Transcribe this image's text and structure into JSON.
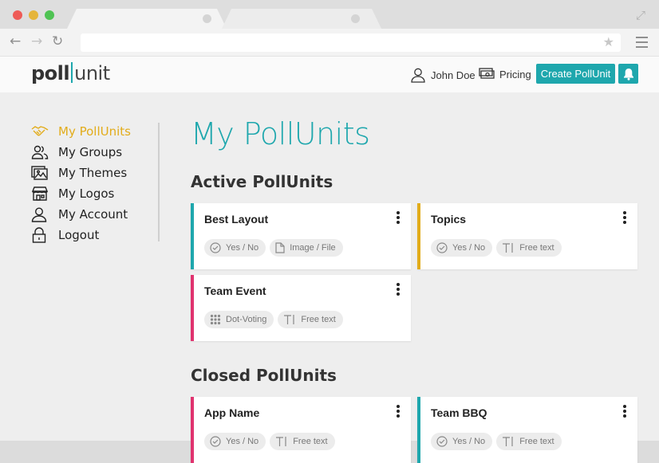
{
  "colors": {
    "brand": "#1ea7ad",
    "active_nav": "#e2ac1a",
    "accent_teal": "#1ea7ad",
    "accent_yellow": "#e2ac1a",
    "accent_pink": "#e0336f"
  },
  "header": {
    "logo_bold": "poll",
    "logo_light": "unit",
    "user_label": "John Doe",
    "pricing_label": "Pricing",
    "create_label": "Create PollUnit"
  },
  "sidebar": {
    "items": [
      {
        "label": "My PollUnits",
        "icon": "handshake-icon"
      },
      {
        "label": "My Groups",
        "icon": "group-icon"
      },
      {
        "label": "My Themes",
        "icon": "image-gallery-icon"
      },
      {
        "label": "My Logos",
        "icon": "storefront-icon"
      },
      {
        "label": "My Account",
        "icon": "user-icon"
      },
      {
        "label": "Logout",
        "icon": "lock-icon"
      }
    ]
  },
  "main": {
    "title": "My PollUnits",
    "active_title": "Active PollUnits",
    "closed_title": "Closed PollUnits",
    "active_cards": [
      {
        "title": "Best Layout",
        "accent": "#1ea7ad",
        "tags": [
          "Yes / No",
          "Image / File"
        ]
      },
      {
        "title": "Topics",
        "accent": "#e2ac1a",
        "tags": [
          "Yes / No",
          "Free text"
        ]
      },
      {
        "title": "Team Event",
        "accent": "#e0336f",
        "tags": [
          "Dot-Voting",
          "Free text"
        ]
      }
    ],
    "closed_cards": [
      {
        "title": "App Name",
        "accent": "#e0336f",
        "tags": [
          "Yes / No",
          "Free text"
        ]
      },
      {
        "title": "Team BBQ",
        "accent": "#1ea7ad",
        "tags": [
          "Yes / No",
          "Free text"
        ]
      }
    ]
  }
}
